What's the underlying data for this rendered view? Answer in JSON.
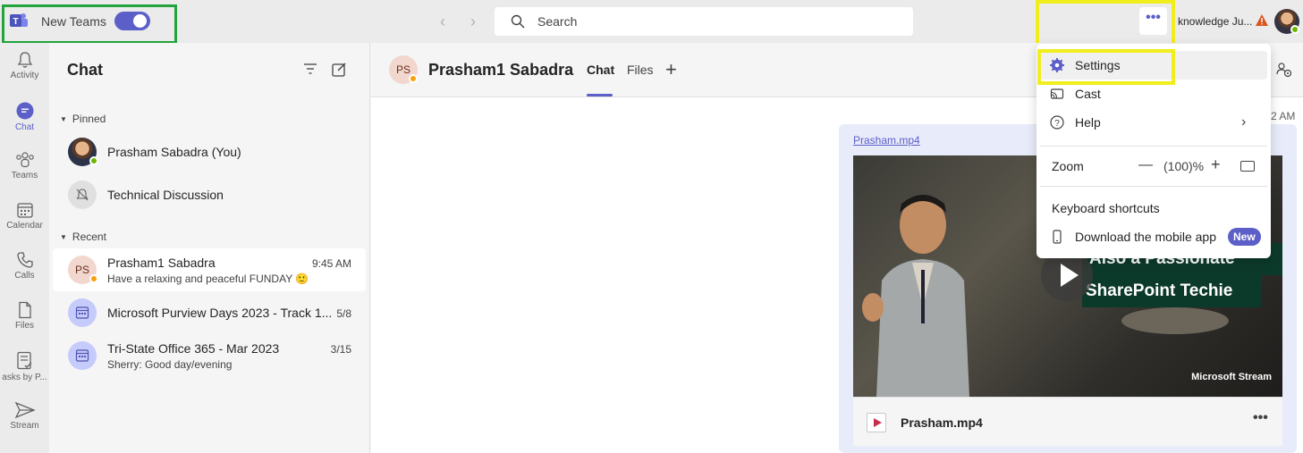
{
  "topbar": {
    "new_teams_label": "New Teams",
    "new_teams_enabled": true,
    "search_placeholder": "Search",
    "more_label": "•••",
    "org_name": "knowledge Ju..."
  },
  "rail": {
    "items": [
      {
        "label": "Activity",
        "icon": "bell-icon"
      },
      {
        "label": "Chat",
        "icon": "chat-icon",
        "active": true
      },
      {
        "label": "Teams",
        "icon": "teams-icon"
      },
      {
        "label": "Calendar",
        "icon": "calendar-icon"
      },
      {
        "label": "Calls",
        "icon": "phone-icon"
      },
      {
        "label": "Files",
        "icon": "file-icon"
      },
      {
        "label": "asks by P...",
        "icon": "tasks-icon"
      },
      {
        "label": "Stream",
        "icon": "stream-icon"
      }
    ]
  },
  "chat_panel": {
    "title": "Chat",
    "pinned_label": "Pinned",
    "recent_label": "Recent",
    "pinned": [
      {
        "name": "Prasham Sabadra (You)"
      },
      {
        "name": "Technical Discussion"
      }
    ],
    "recent": [
      {
        "initials": "PS",
        "name": "Prasham1 Sabadra",
        "time": "9:45 AM",
        "preview": "Have a relaxing and peaceful FUNDAY 🙂"
      },
      {
        "name": "Microsoft Purview Days 2023 - Track 1...",
        "time": "5/8"
      },
      {
        "name": "Tri-State Office 365 - Mar 2023",
        "time": "3/15",
        "preview": "Sherry: Good day/evening"
      }
    ]
  },
  "main": {
    "initials": "PS",
    "contact_name": "Prasham1 Sabadra",
    "tabs": [
      {
        "label": "Chat"
      },
      {
        "label": "Files"
      }
    ],
    "add_tab": "+",
    "timestamp_fragment": "2 AM",
    "message": {
      "file_link": "Prasham.mp4",
      "video_banner_line1": "Also a Passionate",
      "video_banner_line2": "SharePoint Techie",
      "video_watermark": "Microsoft Stream",
      "file_name": "Prasham.mp4",
      "file_more": "•••"
    }
  },
  "menu": {
    "settings": "Settings",
    "cast": "Cast",
    "help": "Help",
    "zoom_label": "Zoom",
    "zoom_minus": "—",
    "zoom_value": "(100)%",
    "zoom_plus": "+",
    "keyboard_shortcuts": "Keyboard shortcuts",
    "download_mobile": "Download the mobile app",
    "new_badge": "New"
  },
  "colors": {
    "brand": "#5b5fc7",
    "highlight_green": "#22a33c",
    "highlight_yellow": "#f1ee1d",
    "away": "#f8a008",
    "available": "#6bb700"
  }
}
